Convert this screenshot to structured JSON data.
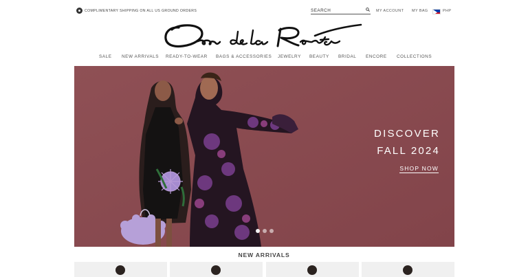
{
  "topbar": {
    "promo_text": "Complimentary shipping on all US ground orders",
    "promo_icon": "shipping-icon",
    "search": {
      "placeholder": "SEARCH",
      "value": ""
    },
    "my_account": "MY ACCOUNT",
    "my_bag": "MY BAG",
    "currency": "PHP",
    "flag_icon": "philippines-flag-icon"
  },
  "logo": {
    "brand": "Oscar de la Renta"
  },
  "nav": {
    "items": [
      {
        "label": "SALE"
      },
      {
        "label": "NEW ARRIVALS"
      },
      {
        "label": "READY-TO-WEAR"
      },
      {
        "label": "BAGS & ACCESSORIES"
      },
      {
        "label": "JEWELRY"
      },
      {
        "label": "BEAUTY"
      },
      {
        "label": "BRIDAL"
      },
      {
        "label": "ENCORE"
      },
      {
        "label": "COLLECTIONS"
      }
    ]
  },
  "hero": {
    "title_line1": "DISCOVER",
    "title_line2": "FALL 2024",
    "cta": "SHOP NOW",
    "background_color": "#8a4b50",
    "slide_count": 3,
    "active_slide": 1
  },
  "new_arrivals": {
    "title": "NEW ARRIVALS",
    "card_count": 4
  }
}
